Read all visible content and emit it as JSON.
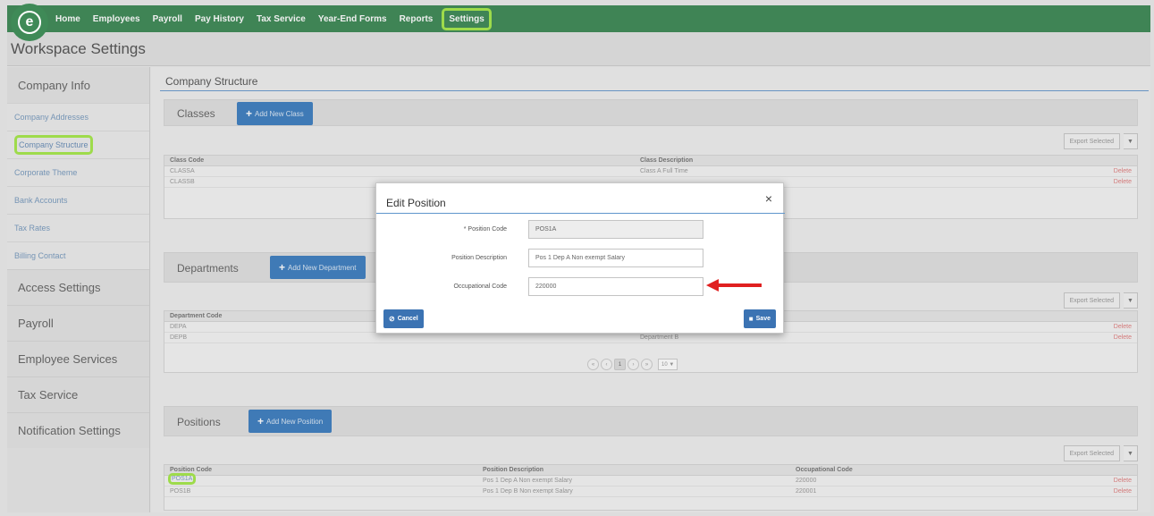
{
  "nav": {
    "logo": "e",
    "items": [
      "Home",
      "Employees",
      "Payroll",
      "Pay History",
      "Tax Service",
      "Year-End Forms",
      "Reports",
      "Settings"
    ],
    "active": "Settings"
  },
  "workspace_title": "Workspace Settings",
  "sidebar": {
    "company_info": "Company Info",
    "sub_items": [
      "Company Addresses",
      "Company Structure",
      "Corporate Theme",
      "Bank Accounts",
      "Tax Rates",
      "Billing Contact"
    ],
    "groups": [
      "Access Settings",
      "Payroll",
      "Employee Services",
      "Tax Service",
      "Notification Settings"
    ]
  },
  "main": {
    "title": "Company Structure",
    "export_label": "Export Selected",
    "export_caret": "▼",
    "delete_label": "Delete",
    "classes": {
      "label": "Classes",
      "add_label": "Add New Class",
      "headers": [
        "Class Code",
        "Class Description"
      ],
      "rows": [
        {
          "code": "CLASSA",
          "desc": "Class A Full Time"
        },
        {
          "code": "CLASSB",
          "desc": ""
        }
      ]
    },
    "departments": {
      "label": "Departments",
      "add_label": "Add New Department",
      "headers": [
        "Department Code"
      ],
      "rows": [
        {
          "code": "DEPA",
          "desc": ""
        },
        {
          "code": "DEPB",
          "desc": "Department B"
        }
      ],
      "pager": {
        "current": "1",
        "page_size": "10 ▼"
      }
    },
    "positions": {
      "label": "Positions",
      "add_label": "Add New Position",
      "headers": [
        "Position Code",
        "Position Description",
        "Occupational Code"
      ],
      "rows": [
        {
          "code": "POS1A",
          "desc": "Pos 1 Dep A Non exempt Salary",
          "occ": "220000"
        },
        {
          "code": "POS1B",
          "desc": "Pos 1 Dep B Non exempt Salary",
          "occ": "220001"
        }
      ]
    }
  },
  "modal": {
    "title": "Edit Position",
    "close": "×",
    "fields": {
      "position_code_label": "* Position Code",
      "position_code_value": "POS1A",
      "position_desc_label": "Position Description",
      "position_desc_value": "Pos 1 Dep A Non exempt Salary",
      "occ_code_label": "Occupational Code",
      "occ_code_value": "220000"
    },
    "cancel_label": "Cancel",
    "save_label": "Save"
  },
  "colors": {
    "nav_green": "#3f8a57",
    "highlight_green": "#a6e94d",
    "button_blue": "#3f7fc1",
    "arrow_red": "#e02020"
  }
}
